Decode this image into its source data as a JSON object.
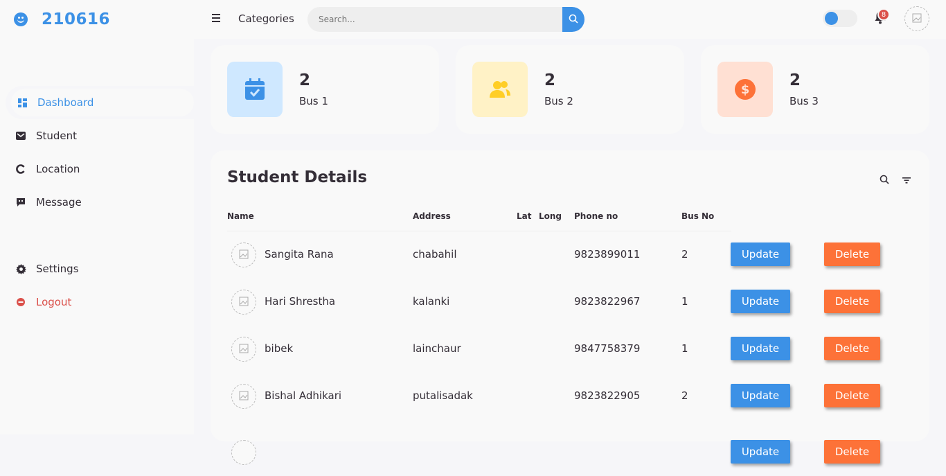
{
  "brand": {
    "icon": "smile-icon",
    "text": "210616"
  },
  "sidebar": {
    "items": [
      {
        "label": "Dashboard",
        "icon": "dashboard-icon",
        "active": true
      },
      {
        "label": "Student",
        "icon": "student-icon"
      },
      {
        "label": "Location",
        "icon": "location-icon"
      },
      {
        "label": "Message",
        "icon": "message-icon"
      }
    ],
    "lower": [
      {
        "label": "Settings",
        "icon": "gear-icon"
      },
      {
        "label": "Logout",
        "icon": "logout-icon"
      }
    ]
  },
  "topbar": {
    "categories_label": "Categories",
    "search_placeholder": "Search...",
    "notification_count": "8"
  },
  "cards": [
    {
      "value": "2",
      "label": "Bus 1",
      "icon": "calendar-check-icon",
      "bg": "#cfe8ff",
      "fg": "#3c91e6"
    },
    {
      "value": "2",
      "label": "Bus 2",
      "icon": "group-icon",
      "bg": "#fff2c6",
      "fg": "#ffce26"
    },
    {
      "value": "2",
      "label": "Bus 3",
      "icon": "dollar-circle-icon",
      "bg": "#ffe0d3",
      "fg": "#fd7238"
    }
  ],
  "table": {
    "title": "Student Details",
    "headers": {
      "name": "Name",
      "address": "Address",
      "lat": "Lat",
      "long": "Long",
      "phone": "Phone no",
      "bus": "Bus No"
    },
    "update_label": "Update",
    "delete_label": "Delete",
    "rows": [
      {
        "name": "Sangita Rana",
        "address": "chabahil",
        "phone": "9823899011",
        "bus": "2"
      },
      {
        "name": "Hari Shrestha",
        "address": "kalanki",
        "phone": "9823822967",
        "bus": "1"
      },
      {
        "name": "bibek",
        "address": "lainchaur",
        "phone": "9847758379",
        "bus": "1"
      },
      {
        "name": "Bishal Adhikari",
        "address": "putalisadak",
        "phone": "9823822905",
        "bus": "2"
      }
    ]
  },
  "colors": {
    "accent": "#3c91e6",
    "danger": "#db504a",
    "orange": "#fd7238"
  }
}
